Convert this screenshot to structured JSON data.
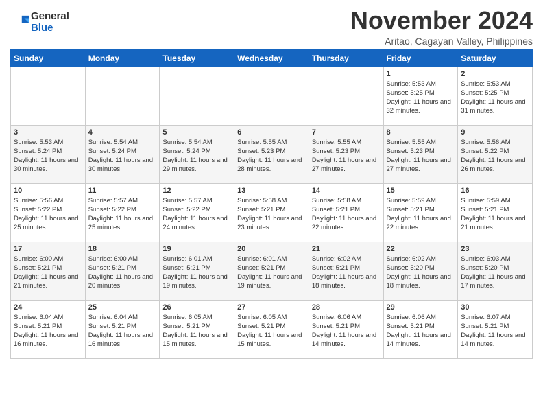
{
  "header": {
    "logo_line1": "General",
    "logo_line2": "Blue",
    "month_title": "November 2024",
    "subtitle": "Aritao, Cagayan Valley, Philippines"
  },
  "days_of_week": [
    "Sunday",
    "Monday",
    "Tuesday",
    "Wednesday",
    "Thursday",
    "Friday",
    "Saturday"
  ],
  "weeks": [
    [
      {
        "day": "",
        "info": ""
      },
      {
        "day": "",
        "info": ""
      },
      {
        "day": "",
        "info": ""
      },
      {
        "day": "",
        "info": ""
      },
      {
        "day": "",
        "info": ""
      },
      {
        "day": "1",
        "info": "Sunrise: 5:53 AM\nSunset: 5:25 PM\nDaylight: 11 hours and 32 minutes."
      },
      {
        "day": "2",
        "info": "Sunrise: 5:53 AM\nSunset: 5:25 PM\nDaylight: 11 hours and 31 minutes."
      }
    ],
    [
      {
        "day": "3",
        "info": "Sunrise: 5:53 AM\nSunset: 5:24 PM\nDaylight: 11 hours and 30 minutes."
      },
      {
        "day": "4",
        "info": "Sunrise: 5:54 AM\nSunset: 5:24 PM\nDaylight: 11 hours and 30 minutes."
      },
      {
        "day": "5",
        "info": "Sunrise: 5:54 AM\nSunset: 5:24 PM\nDaylight: 11 hours and 29 minutes."
      },
      {
        "day": "6",
        "info": "Sunrise: 5:55 AM\nSunset: 5:23 PM\nDaylight: 11 hours and 28 minutes."
      },
      {
        "day": "7",
        "info": "Sunrise: 5:55 AM\nSunset: 5:23 PM\nDaylight: 11 hours and 27 minutes."
      },
      {
        "day": "8",
        "info": "Sunrise: 5:55 AM\nSunset: 5:23 PM\nDaylight: 11 hours and 27 minutes."
      },
      {
        "day": "9",
        "info": "Sunrise: 5:56 AM\nSunset: 5:22 PM\nDaylight: 11 hours and 26 minutes."
      }
    ],
    [
      {
        "day": "10",
        "info": "Sunrise: 5:56 AM\nSunset: 5:22 PM\nDaylight: 11 hours and 25 minutes."
      },
      {
        "day": "11",
        "info": "Sunrise: 5:57 AM\nSunset: 5:22 PM\nDaylight: 11 hours and 25 minutes."
      },
      {
        "day": "12",
        "info": "Sunrise: 5:57 AM\nSunset: 5:22 PM\nDaylight: 11 hours and 24 minutes."
      },
      {
        "day": "13",
        "info": "Sunrise: 5:58 AM\nSunset: 5:21 PM\nDaylight: 11 hours and 23 minutes."
      },
      {
        "day": "14",
        "info": "Sunrise: 5:58 AM\nSunset: 5:21 PM\nDaylight: 11 hours and 22 minutes."
      },
      {
        "day": "15",
        "info": "Sunrise: 5:59 AM\nSunset: 5:21 PM\nDaylight: 11 hours and 22 minutes."
      },
      {
        "day": "16",
        "info": "Sunrise: 5:59 AM\nSunset: 5:21 PM\nDaylight: 11 hours and 21 minutes."
      }
    ],
    [
      {
        "day": "17",
        "info": "Sunrise: 6:00 AM\nSunset: 5:21 PM\nDaylight: 11 hours and 21 minutes."
      },
      {
        "day": "18",
        "info": "Sunrise: 6:00 AM\nSunset: 5:21 PM\nDaylight: 11 hours and 20 minutes."
      },
      {
        "day": "19",
        "info": "Sunrise: 6:01 AM\nSunset: 5:21 PM\nDaylight: 11 hours and 19 minutes."
      },
      {
        "day": "20",
        "info": "Sunrise: 6:01 AM\nSunset: 5:21 PM\nDaylight: 11 hours and 19 minutes."
      },
      {
        "day": "21",
        "info": "Sunrise: 6:02 AM\nSunset: 5:21 PM\nDaylight: 11 hours and 18 minutes."
      },
      {
        "day": "22",
        "info": "Sunrise: 6:02 AM\nSunset: 5:20 PM\nDaylight: 11 hours and 18 minutes."
      },
      {
        "day": "23",
        "info": "Sunrise: 6:03 AM\nSunset: 5:20 PM\nDaylight: 11 hours and 17 minutes."
      }
    ],
    [
      {
        "day": "24",
        "info": "Sunrise: 6:04 AM\nSunset: 5:21 PM\nDaylight: 11 hours and 16 minutes."
      },
      {
        "day": "25",
        "info": "Sunrise: 6:04 AM\nSunset: 5:21 PM\nDaylight: 11 hours and 16 minutes."
      },
      {
        "day": "26",
        "info": "Sunrise: 6:05 AM\nSunset: 5:21 PM\nDaylight: 11 hours and 15 minutes."
      },
      {
        "day": "27",
        "info": "Sunrise: 6:05 AM\nSunset: 5:21 PM\nDaylight: 11 hours and 15 minutes."
      },
      {
        "day": "28",
        "info": "Sunrise: 6:06 AM\nSunset: 5:21 PM\nDaylight: 11 hours and 14 minutes."
      },
      {
        "day": "29",
        "info": "Sunrise: 6:06 AM\nSunset: 5:21 PM\nDaylight: 11 hours and 14 minutes."
      },
      {
        "day": "30",
        "info": "Sunrise: 6:07 AM\nSunset: 5:21 PM\nDaylight: 11 hours and 14 minutes."
      }
    ]
  ]
}
